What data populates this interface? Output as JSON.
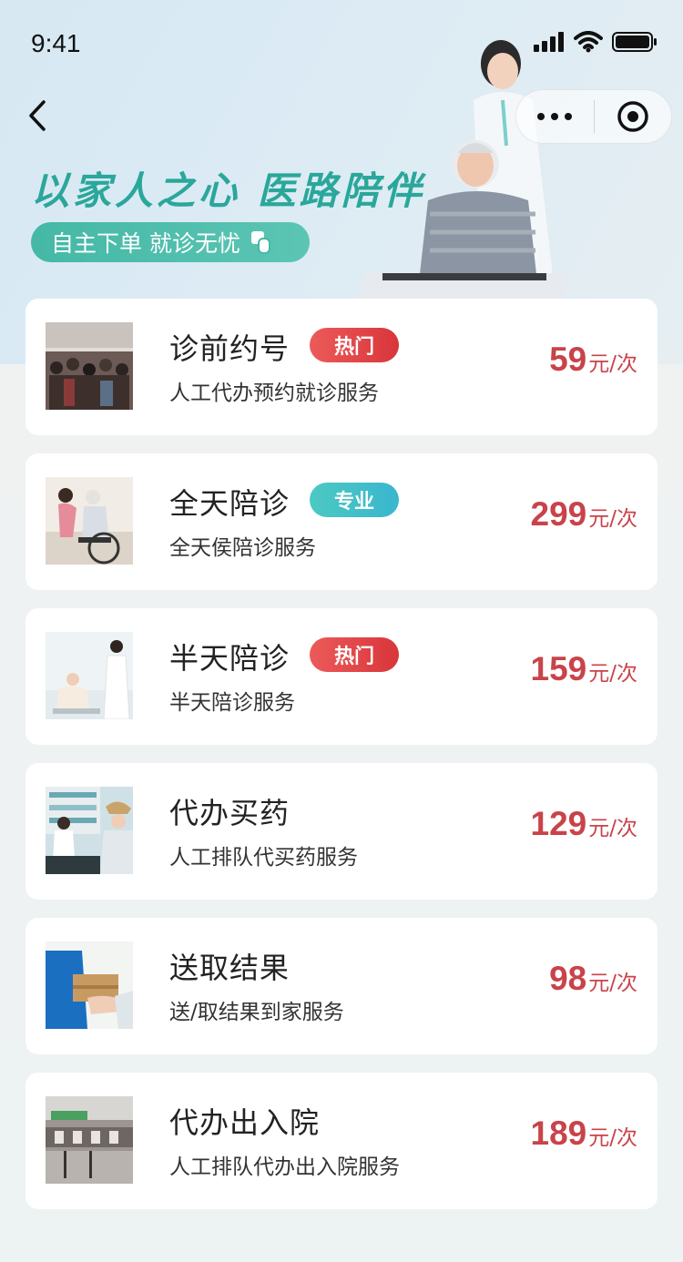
{
  "status_bar": {
    "time": "9:41"
  },
  "header": {
    "slogan": "以家人之心  医路陪伴",
    "sub_slogan": "自主下单 就诊无忧"
  },
  "services": [
    {
      "title": "诊前约号",
      "badge": "热门",
      "badge_type": "hot",
      "subtitle": "人工代办预约就诊服务",
      "price": "59",
      "unit": "元/次"
    },
    {
      "title": "全天陪诊",
      "badge": "专业",
      "badge_type": "pro",
      "subtitle": "全天侯陪诊服务",
      "price": "299",
      "unit": "元/次"
    },
    {
      "title": "半天陪诊",
      "badge": "热门",
      "badge_type": "hot",
      "subtitle": "半天陪诊服务",
      "price": "159",
      "unit": "元/次"
    },
    {
      "title": "代办买药",
      "badge": "",
      "badge_type": "",
      "subtitle": "人工排队代买药服务",
      "price": "129",
      "unit": "元/次"
    },
    {
      "title": "送取结果",
      "badge": "",
      "badge_type": "",
      "subtitle": "送/取结果到家服务",
      "price": "98",
      "unit": "元/次"
    },
    {
      "title": "代办出入院",
      "badge": "",
      "badge_type": "",
      "subtitle": "人工排队代办出入院服务",
      "price": "189",
      "unit": "元/次"
    }
  ],
  "colors": {
    "accent": "#2aa79b",
    "price": "#c9434a",
    "hot": "#d8363a",
    "pro": "#3ab6cf"
  }
}
